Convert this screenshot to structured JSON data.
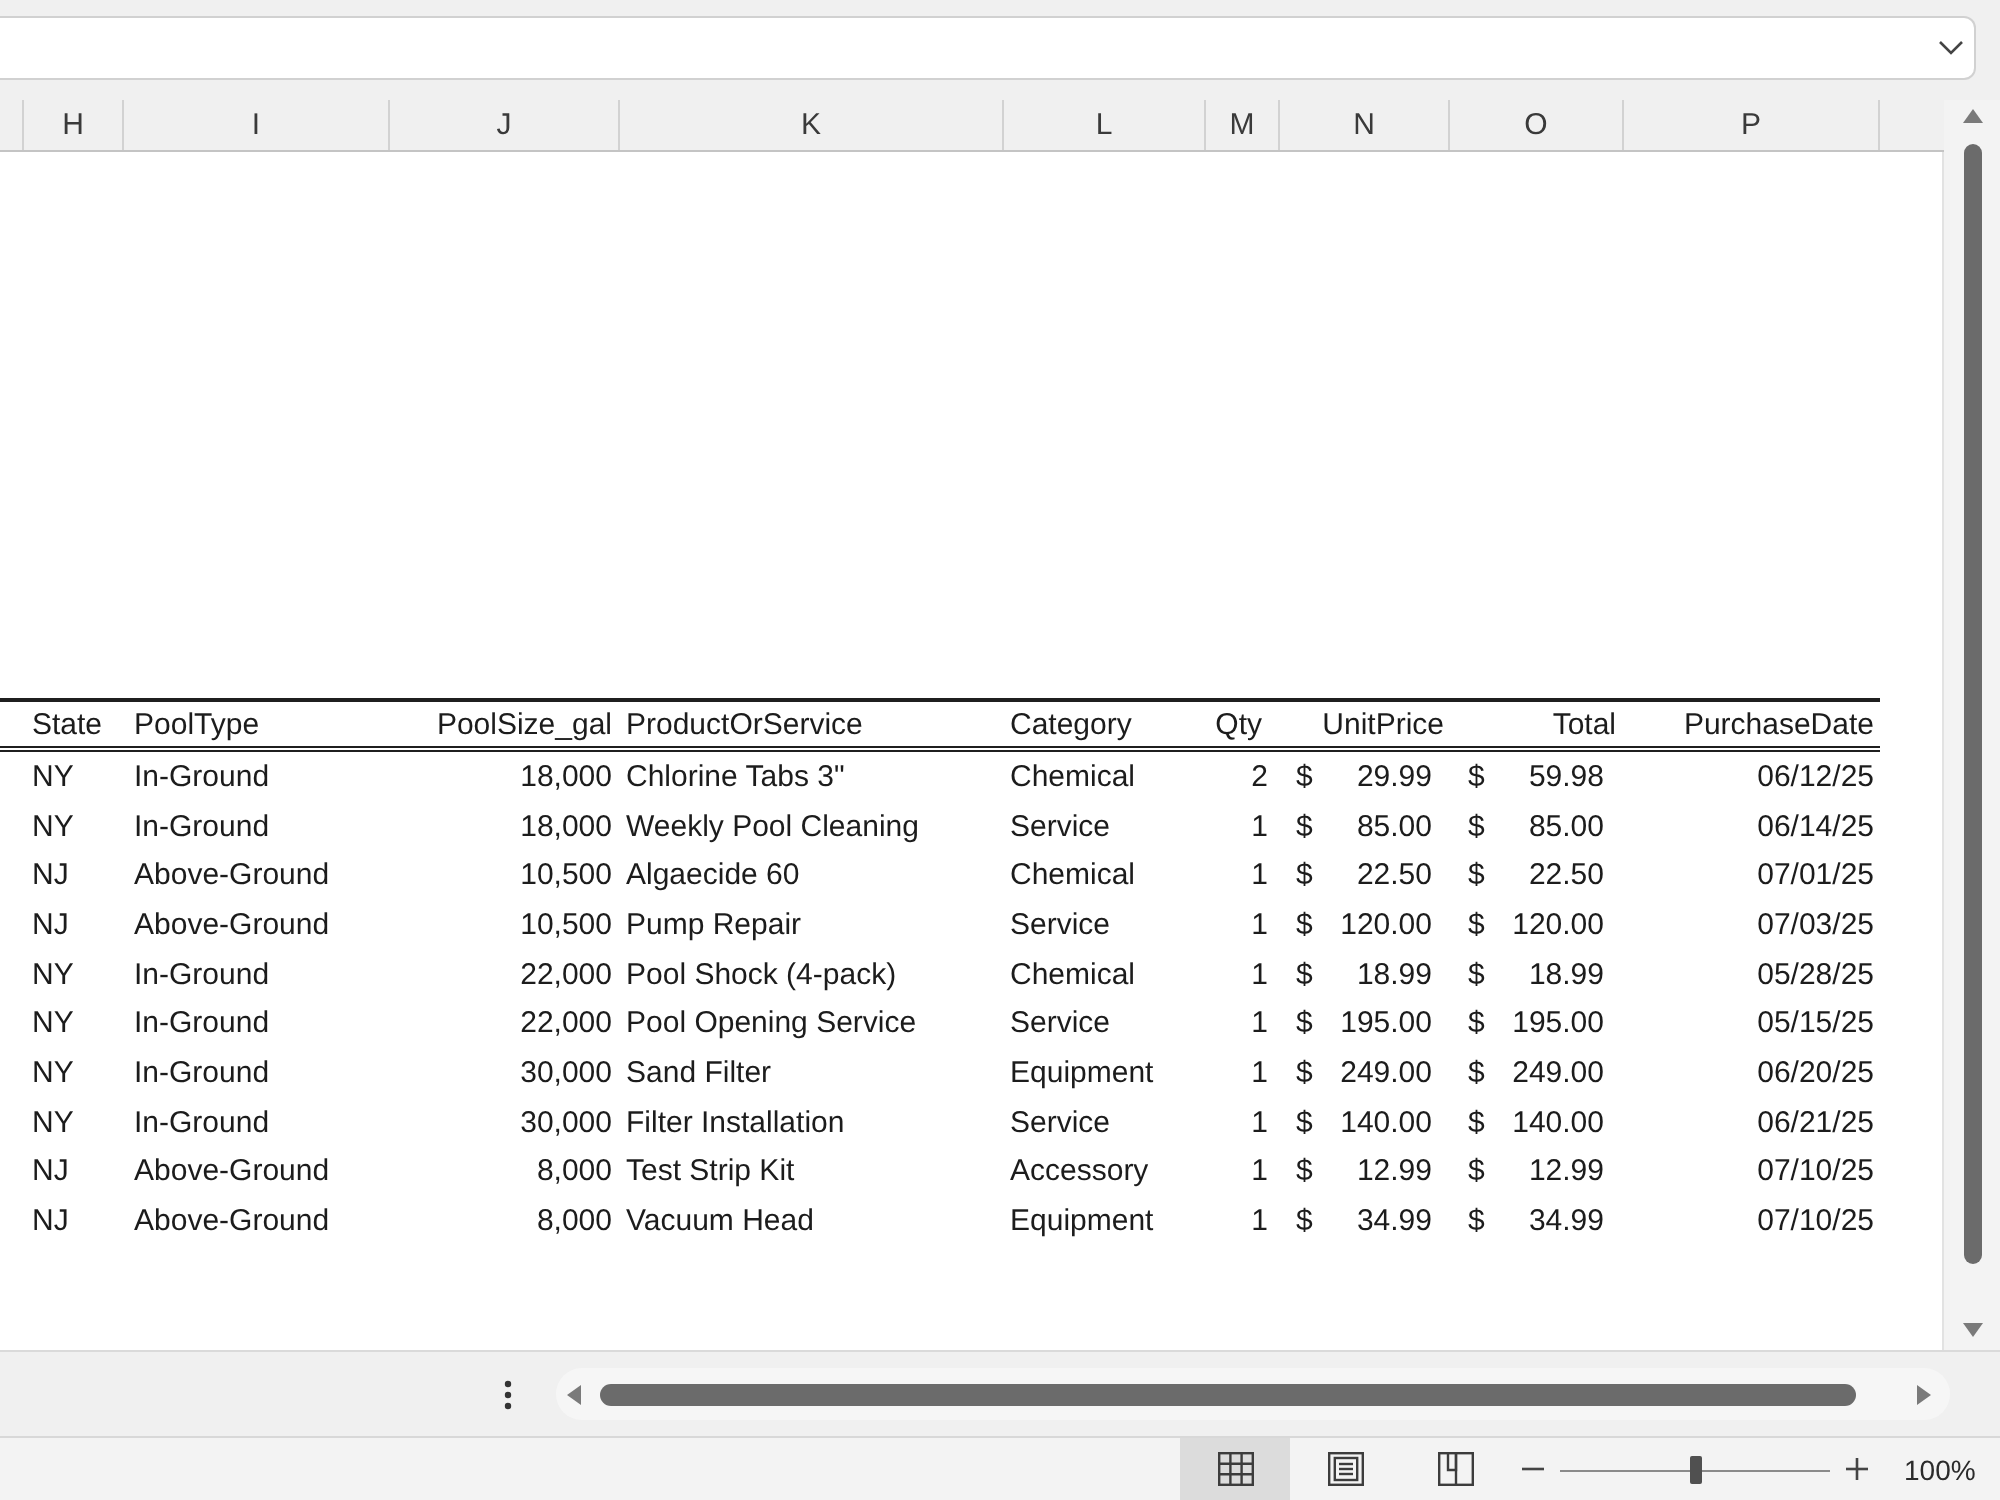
{
  "column_headers": [
    "H",
    "I",
    "J",
    "K",
    "L",
    "M",
    "N",
    "O",
    "P"
  ],
  "table": {
    "columns": [
      "State",
      "PoolType",
      "PoolSize_gal",
      "ProductOrService",
      "Category",
      "Qty",
      "UnitPrice",
      "Total",
      "PurchaseDate"
    ],
    "rows": [
      {
        "state": "NY",
        "pool_type": "In-Ground",
        "pool_size_gal": "18,000",
        "product_or_service": "Chlorine Tabs 3\"",
        "category": "Chemical",
        "qty": "2",
        "unit_price": {
          "currency": "$",
          "amount": "29.99"
        },
        "total": {
          "currency": "$",
          "amount": "59.98"
        },
        "purchase_date": "06/12/25"
      },
      {
        "state": "NY",
        "pool_type": "In-Ground",
        "pool_size_gal": "18,000",
        "product_or_service": "Weekly Pool Cleaning",
        "category": "Service",
        "qty": "1",
        "unit_price": {
          "currency": "$",
          "amount": "85.00"
        },
        "total": {
          "currency": "$",
          "amount": "85.00"
        },
        "purchase_date": "06/14/25"
      },
      {
        "state": "NJ",
        "pool_type": "Above-Ground",
        "pool_size_gal": "10,500",
        "product_or_service": "Algaecide 60",
        "category": "Chemical",
        "qty": "1",
        "unit_price": {
          "currency": "$",
          "amount": "22.50"
        },
        "total": {
          "currency": "$",
          "amount": "22.50"
        },
        "purchase_date": "07/01/25"
      },
      {
        "state": "NJ",
        "pool_type": "Above-Ground",
        "pool_size_gal": "10,500",
        "product_or_service": "Pump Repair",
        "category": "Service",
        "qty": "1",
        "unit_price": {
          "currency": "$",
          "amount": "120.00"
        },
        "total": {
          "currency": "$",
          "amount": "120.00"
        },
        "purchase_date": "07/03/25"
      },
      {
        "state": "NY",
        "pool_type": "In-Ground",
        "pool_size_gal": "22,000",
        "product_or_service": "Pool Shock (4-pack)",
        "category": "Chemical",
        "qty": "1",
        "unit_price": {
          "currency": "$",
          "amount": "18.99"
        },
        "total": {
          "currency": "$",
          "amount": "18.99"
        },
        "purchase_date": "05/28/25"
      },
      {
        "state": "NY",
        "pool_type": "In-Ground",
        "pool_size_gal": "22,000",
        "product_or_service": "Pool Opening Service",
        "category": "Service",
        "qty": "1",
        "unit_price": {
          "currency": "$",
          "amount": "195.00"
        },
        "total": {
          "currency": "$",
          "amount": "195.00"
        },
        "purchase_date": "05/15/25"
      },
      {
        "state": "NY",
        "pool_type": "In-Ground",
        "pool_size_gal": "30,000",
        "product_or_service": "Sand Filter",
        "category": "Equipment",
        "qty": "1",
        "unit_price": {
          "currency": "$",
          "amount": "249.00"
        },
        "total": {
          "currency": "$",
          "amount": "249.00"
        },
        "purchase_date": "06/20/25"
      },
      {
        "state": "NY",
        "pool_type": "In-Ground",
        "pool_size_gal": "30,000",
        "product_or_service": "Filter Installation",
        "category": "Service",
        "qty": "1",
        "unit_price": {
          "currency": "$",
          "amount": "140.00"
        },
        "total": {
          "currency": "$",
          "amount": "140.00"
        },
        "purchase_date": "06/21/25"
      },
      {
        "state": "NJ",
        "pool_type": "Above-Ground",
        "pool_size_gal": "8,000",
        "product_or_service": "Test Strip Kit",
        "category": "Accessory",
        "qty": "1",
        "unit_price": {
          "currency": "$",
          "amount": "12.99"
        },
        "total": {
          "currency": "$",
          "amount": "12.99"
        },
        "purchase_date": "07/10/25"
      },
      {
        "state": "NJ",
        "pool_type": "Above-Ground",
        "pool_size_gal": "8,000",
        "product_or_service": "Vacuum Head",
        "category": "Equipment",
        "qty": "1",
        "unit_price": {
          "currency": "$",
          "amount": "34.99"
        },
        "total": {
          "currency": "$",
          "amount": "34.99"
        },
        "purchase_date": "07/10/25"
      }
    ]
  },
  "views": [
    {
      "kind": "normal",
      "selected": true
    },
    {
      "kind": "page_layout",
      "selected": false
    },
    {
      "kind": "page_break",
      "selected": false
    }
  ],
  "zoom": {
    "level": 0.5,
    "percent": "100%"
  }
}
